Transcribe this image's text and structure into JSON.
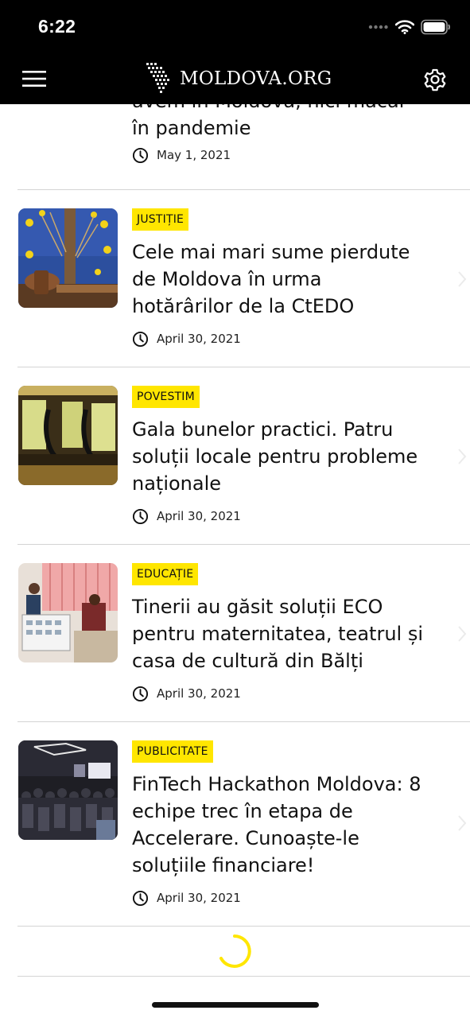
{
  "status_bar": {
    "time": "6:22"
  },
  "app_bar": {
    "logo_text": "MOLDOVA.ORG",
    "menu_icon": "hamburger-menu-icon",
    "settings_icon": "gear-icon"
  },
  "partial_article": {
    "title_lines": [
      "avem în Moldova, nici măcar",
      "în pandemie"
    ],
    "date": "May 1, 2021"
  },
  "articles": [
    {
      "category": "JUSTIȚIE",
      "title": "Cele mai mari sume pierdute de Moldova în urma hotărârilor de la CtEDO",
      "date": "April 30, 2021"
    },
    {
      "category": "POVESTIM",
      "title": "Gala bunelor practici. Patru soluții locale pentru probleme naționale",
      "date": "April 30, 2021"
    },
    {
      "category": "EDUCAȚIE",
      "title": "Tinerii au găsit soluții ECO pentru maternitatea, teatrul și casa de cultură din Bălți",
      "date": "April 30, 2021"
    },
    {
      "category": "PUBLICITATE",
      "title": "FinTech Hackathon Moldova: 8 echipe trec în etapa de Accelerare. Cunoaște-le soluțiile financiare!",
      "date": "April 30, 2021"
    }
  ],
  "colors": {
    "accent": "#ffe600",
    "header_bg": "#000000",
    "divider": "#d4d4d4"
  }
}
